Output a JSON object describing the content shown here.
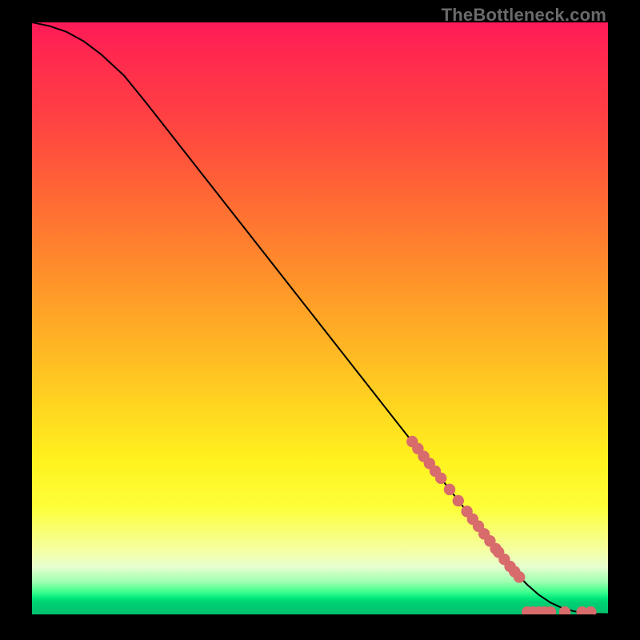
{
  "watermark": "TheBottleneck.com",
  "colors": {
    "background": "#000000",
    "curve": "#000000",
    "marker": "#d86b6b"
  },
  "chart_data": {
    "type": "line",
    "title": "",
    "xlabel": "",
    "ylabel": "",
    "xlim": [
      0,
      100
    ],
    "ylim": [
      0,
      100
    ],
    "grid": false,
    "series": [
      {
        "name": "bottleneck-curve",
        "x": [
          0,
          3,
          6,
          9,
          12,
          16,
          20,
          25,
          30,
          35,
          40,
          45,
          50,
          55,
          60,
          65,
          70,
          75,
          79,
          82,
          84,
          86,
          88,
          90,
          92,
          94,
          96,
          98,
          100
        ],
        "y": [
          100,
          99.4,
          98.4,
          96.8,
          94.6,
          91.0,
          86.2,
          80.0,
          73.8,
          67.6,
          61.4,
          55.2,
          49.0,
          42.8,
          36.6,
          30.4,
          24.2,
          18.0,
          13.0,
          9.3,
          7.0,
          5.0,
          3.3,
          2.0,
          1.1,
          0.55,
          0.25,
          0.1,
          0.05
        ]
      }
    ],
    "markers": {
      "name": "scatter-points",
      "description": "salmon dots sampled along the lower-right part of the curve and along the x-axis tail",
      "points": [
        {
          "x": 66,
          "y": 29.2
        },
        {
          "x": 67,
          "y": 28.0
        },
        {
          "x": 68,
          "y": 26.7
        },
        {
          "x": 69,
          "y": 25.5
        },
        {
          "x": 70,
          "y": 24.2
        },
        {
          "x": 71,
          "y": 23.0
        },
        {
          "x": 72.5,
          "y": 21.1
        },
        {
          "x": 74,
          "y": 19.2
        },
        {
          "x": 75.5,
          "y": 17.4
        },
        {
          "x": 76.5,
          "y": 16.1
        },
        {
          "x": 77.5,
          "y": 14.9
        },
        {
          "x": 78.5,
          "y": 13.6
        },
        {
          "x": 79.5,
          "y": 12.4
        },
        {
          "x": 80.5,
          "y": 11.1
        },
        {
          "x": 81,
          "y": 10.5
        },
        {
          "x": 82,
          "y": 9.3
        },
        {
          "x": 83,
          "y": 8.1
        },
        {
          "x": 83.8,
          "y": 7.2
        },
        {
          "x": 84.6,
          "y": 6.3
        },
        {
          "x": 86,
          "y": 0.4
        },
        {
          "x": 87,
          "y": 0.4
        },
        {
          "x": 88,
          "y": 0.4
        },
        {
          "x": 89,
          "y": 0.4
        },
        {
          "x": 90,
          "y": 0.4
        },
        {
          "x": 92.5,
          "y": 0.4
        },
        {
          "x": 95.5,
          "y": 0.4
        },
        {
          "x": 97,
          "y": 0.4
        }
      ]
    }
  }
}
